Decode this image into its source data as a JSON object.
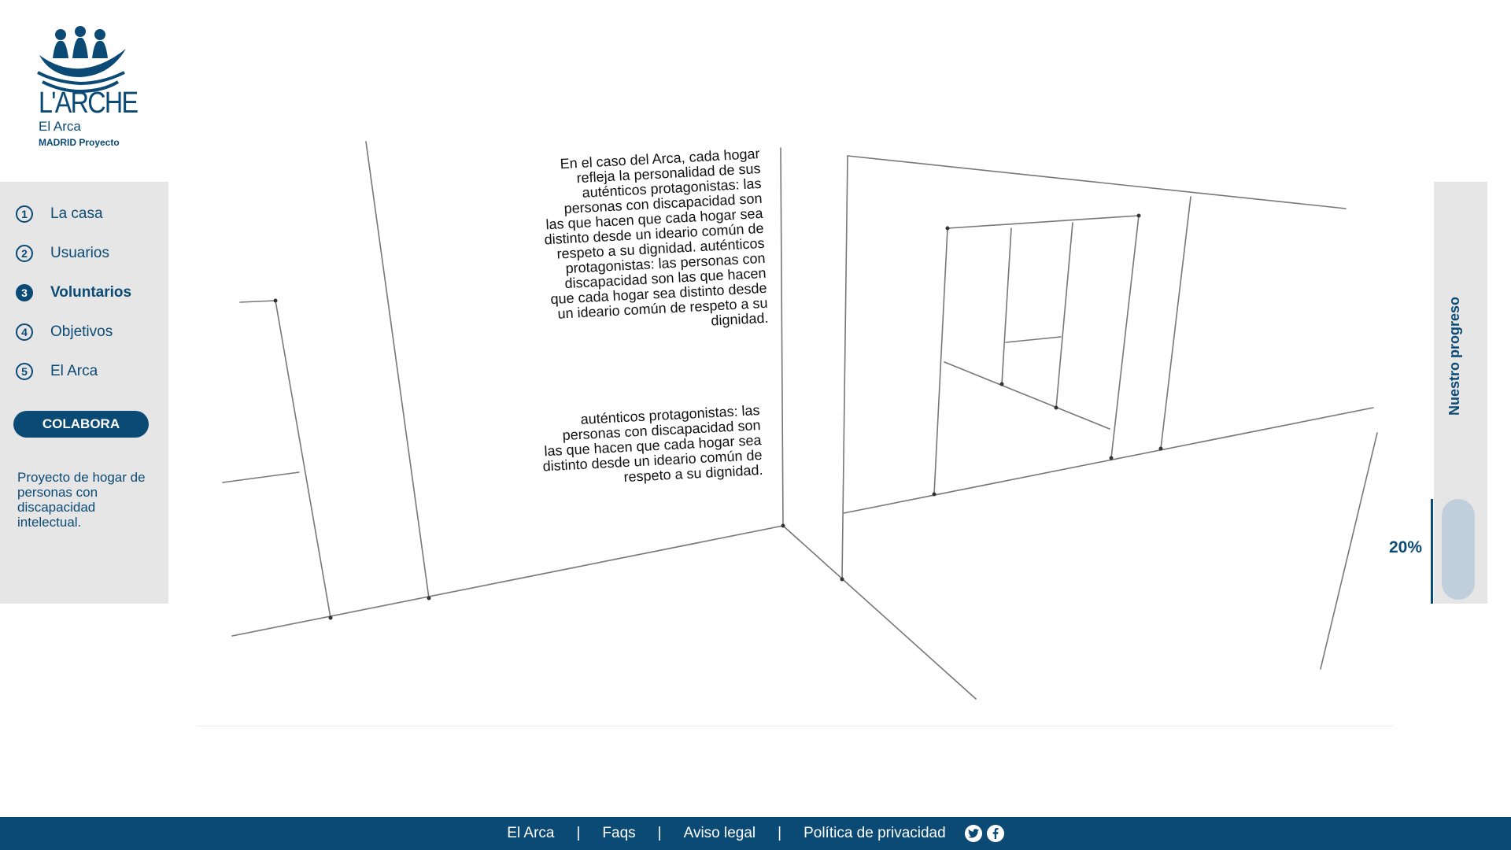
{
  "logo": {
    "brand": "L'ARCHE",
    "name": "El Arca",
    "subtitle": "MADRID Proyecto"
  },
  "nav": {
    "items": [
      {
        "num": "1",
        "label": "La casa"
      },
      {
        "num": "2",
        "label": "Usuarios"
      },
      {
        "num": "3",
        "label": "Voluntarios",
        "active": true
      },
      {
        "num": "4",
        "label": "Objetivos"
      },
      {
        "num": "5",
        "label": "El Arca"
      }
    ],
    "cta": "COLABORA",
    "description": "Proyecto de hogar de personas con discapacidad intelectual."
  },
  "content": {
    "paragraph1": "En el caso del Arca, cada hogar refleja la personalidad de sus auténticos protagonistas: las personas con discapacidad son las que hacen que cada hogar sea distinto desde un ideario común de respeto a su dignidad. auténticos protagonistas: las personas con discapacidad son las que hacen que cada hogar sea distinto desde un ideario común de respeto a su dignidad.",
    "paragraph2": "auténticos protagonistas: las personas con discapacidad son las que hacen que cada hogar sea distinto desde un ideario común de respeto a su dignidad."
  },
  "progress": {
    "title": "Nuestro progreso",
    "percent_label": "20%",
    "value": 0.2
  },
  "footer": {
    "links": [
      "El Arca",
      "Faqs",
      "Aviso legal",
      "Política de privacidad"
    ],
    "separator": "|",
    "social": [
      "twitter-icon",
      "facebook-icon"
    ]
  },
  "colors": {
    "brand": "#0b4a75",
    "panel": "#e6e6e6",
    "progress_track": "#c1cfdc"
  }
}
